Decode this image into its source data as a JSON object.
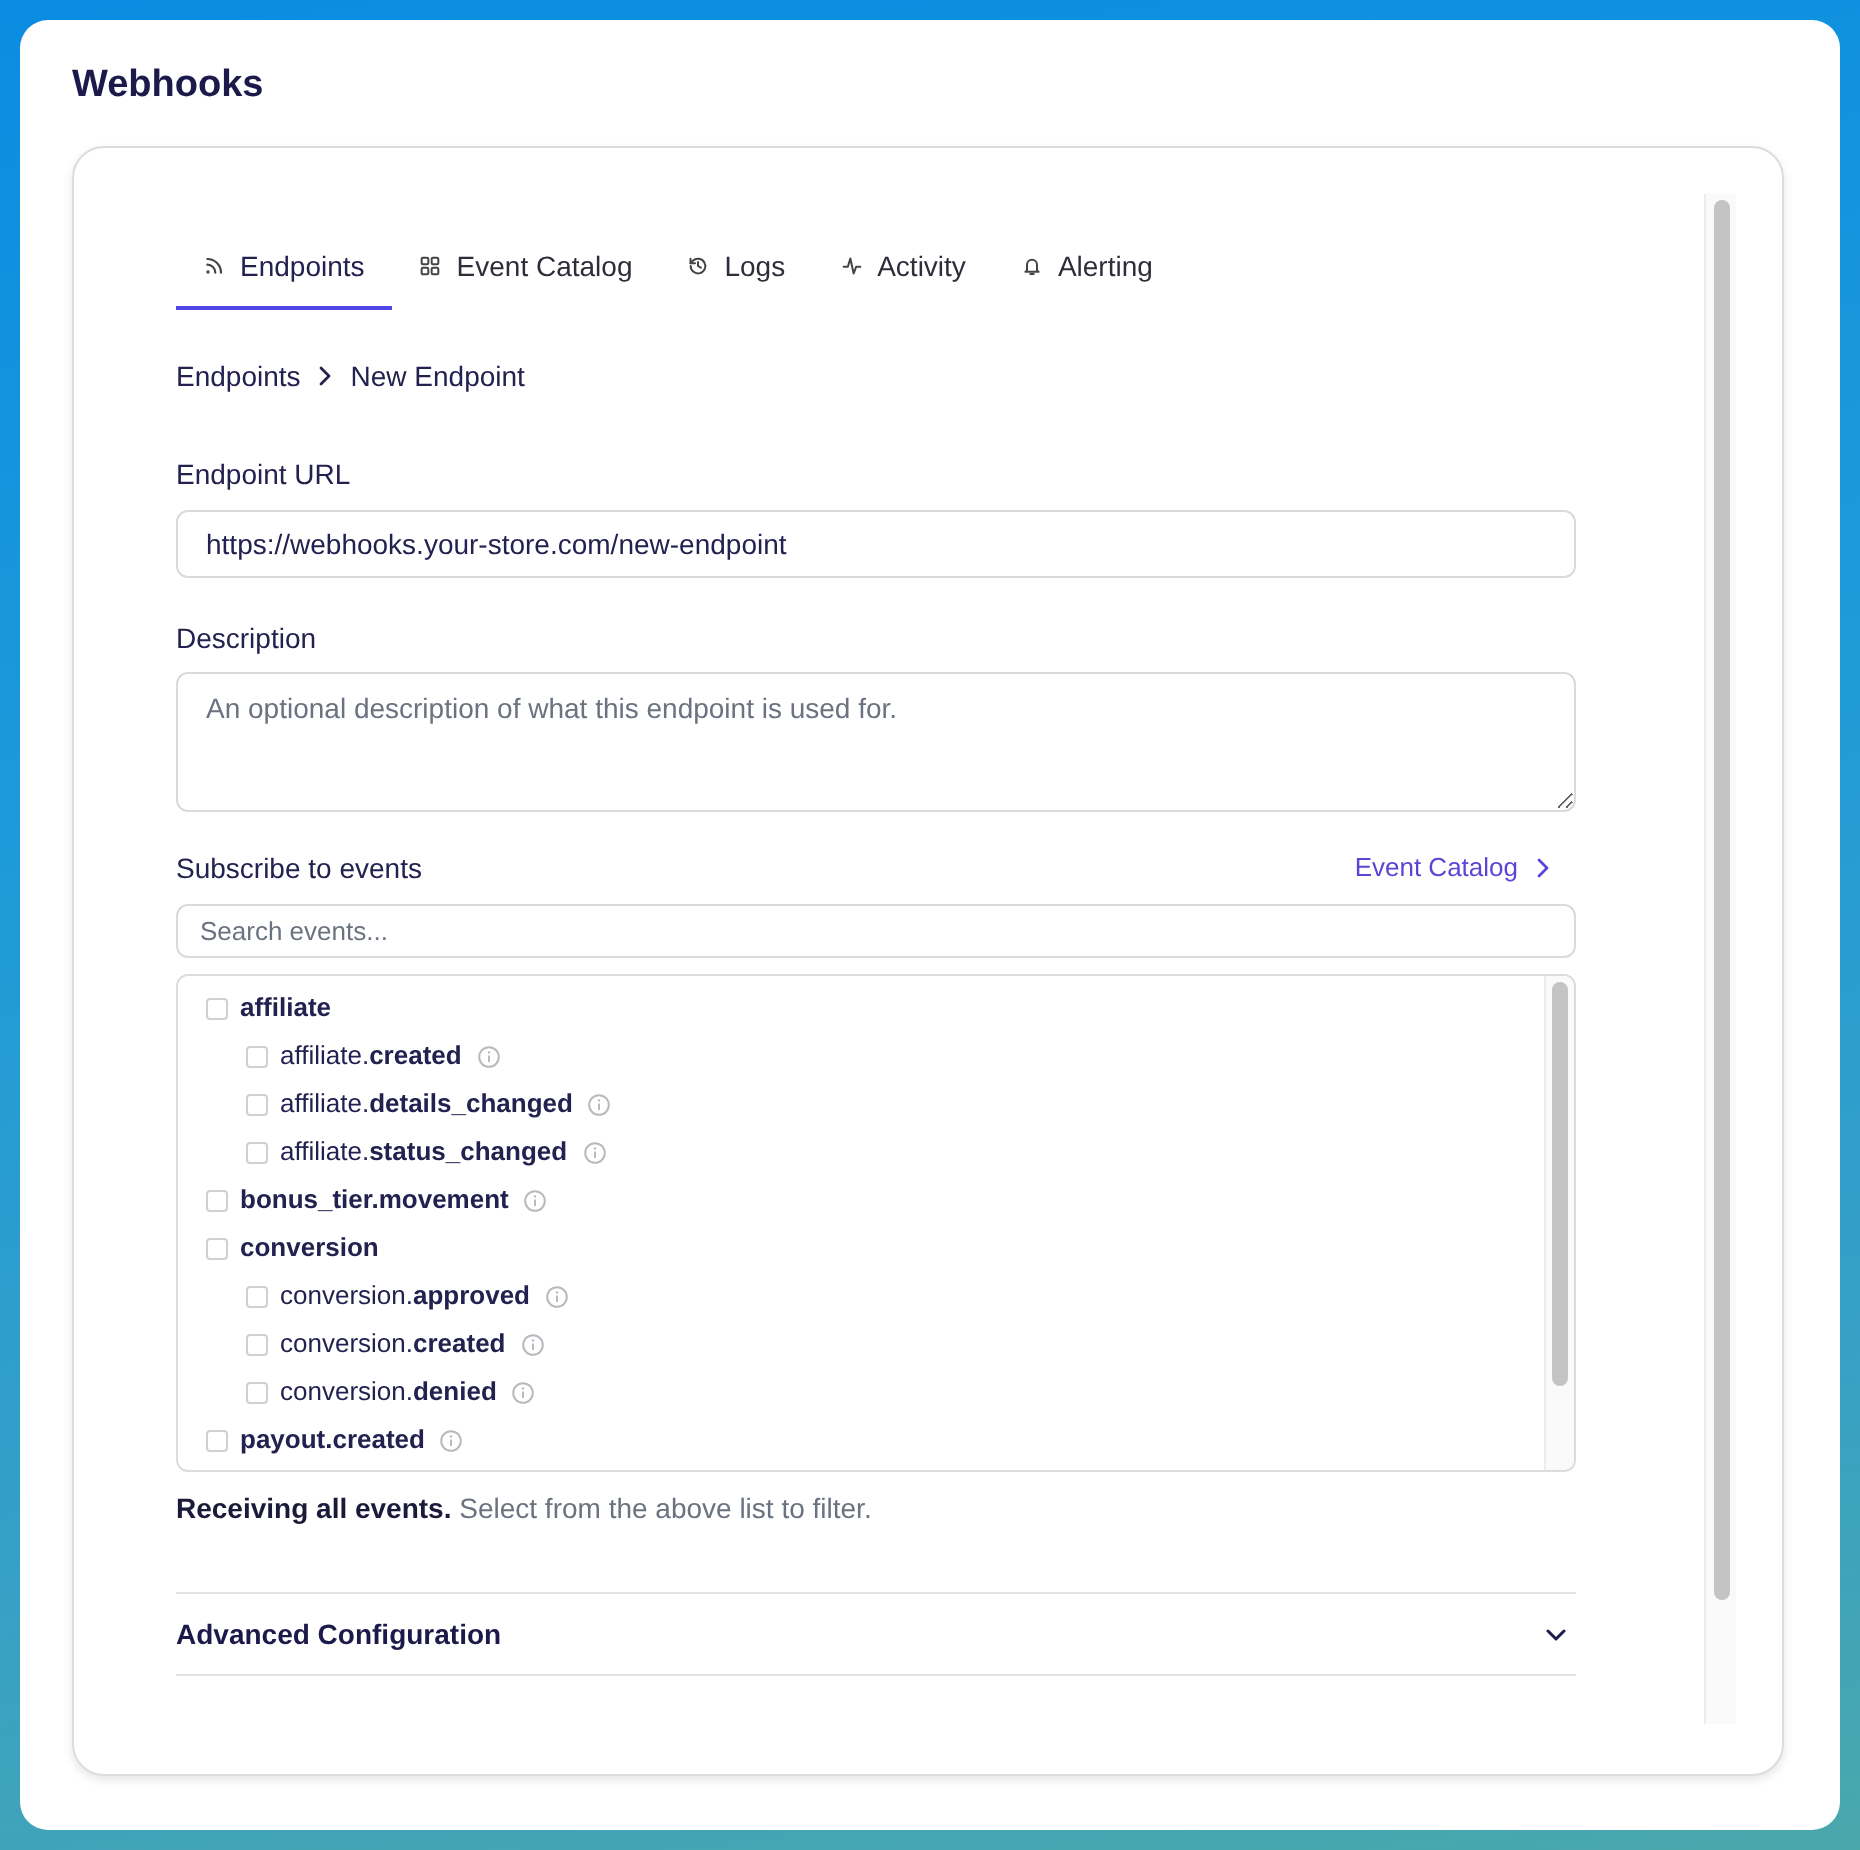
{
  "title": "Webhooks",
  "tabs": [
    {
      "label": "Endpoints",
      "selected": true
    },
    {
      "label": "Event Catalog",
      "selected": false
    },
    {
      "label": "Logs",
      "selected": false
    },
    {
      "label": "Activity",
      "selected": false
    },
    {
      "label": "Alerting",
      "selected": false
    }
  ],
  "breadcrumb": [
    "Endpoints",
    "New Endpoint"
  ],
  "endpoint_url": {
    "label": "Endpoint URL",
    "value": "https://webhooks.your-store.com/new-endpoint"
  },
  "description": {
    "label": "Description",
    "placeholder": "An optional description of what this endpoint is used for."
  },
  "subscribe": {
    "label": "Subscribe to events",
    "link": "Event Catalog",
    "search": {
      "placeholder": "Search events..."
    },
    "events": [
      {
        "label": "affiliate",
        "checked": false,
        "children": [
          {
            "label": "affiliate.**created**",
            "checked": false
          },
          {
            "label": "affiliate.**details_changed**",
            "checked": false
          },
          {
            "label": "affiliate.**status_changed**",
            "checked": false
          }
        ]
      },
      {
        "label": "bonus_tier.movement",
        "checked": false
      },
      {
        "label": "conversion",
        "checked": false,
        "children": [
          {
            "label": "conversion.**approved**",
            "checked": false
          },
          {
            "label": "conversion.**created**",
            "checked": false
          },
          {
            "label": "conversion.**denied**",
            "checked": false
          }
        ]
      },
      {
        "label": "payout.created",
        "checked": false
      }
    ],
    "summary": "**Receiving all events.** Select from the above list to filter."
  },
  "advanced": {
    "label": "Advanced Configuration",
    "expanded": false
  }
}
